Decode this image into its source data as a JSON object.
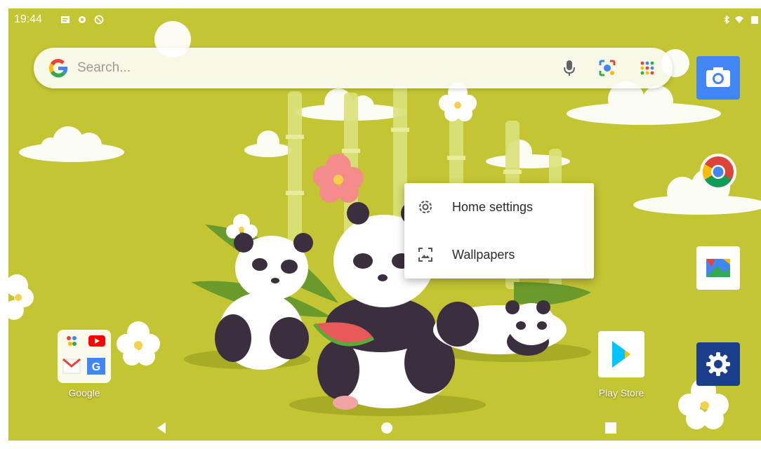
{
  "status_bar": {
    "time": "19:44",
    "left_icons": [
      "message-icon",
      "settings-icon",
      "vpn-icon"
    ],
    "right_icons": [
      "bluetooth-icon",
      "wifi-icon",
      "battery-icon"
    ]
  },
  "search": {
    "placeholder": "Search...",
    "icons": [
      "google-logo-icon",
      "mic-icon",
      "lens-icon",
      "apps-grid-icon"
    ]
  },
  "context_menu": {
    "items": [
      {
        "label": "Home settings",
        "icon": "gear-icon"
      },
      {
        "label": "Wallpapers",
        "icon": "wallpaper-icon"
      }
    ]
  },
  "home_apps": {
    "folder_label": "Google",
    "play_store_label": "Play Store"
  },
  "dock": {
    "apps": [
      "camera-icon",
      "chrome-icon",
      "files-icon",
      "settings-icon"
    ]
  },
  "nav": {
    "buttons": [
      "back-button",
      "home-button",
      "recents-button"
    ]
  },
  "colors": {
    "wallpaper": "#c3c533",
    "camera": "#4285f4",
    "settings": "#1a3d8c"
  }
}
